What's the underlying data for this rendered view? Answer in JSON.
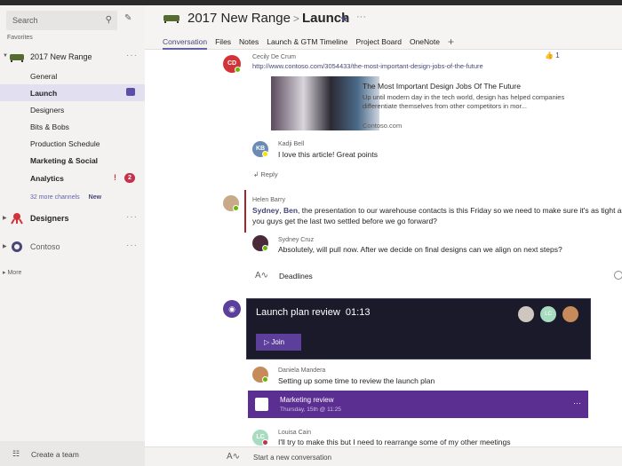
{
  "sidebar": {
    "search_placeholder": "Search",
    "favorites_label": "Favorites",
    "teams": [
      {
        "name": "2017 New Range",
        "channels": [
          {
            "name": "General",
            "bold": false,
            "active": false
          },
          {
            "name": "Launch",
            "bold": true,
            "active": true,
            "meeting": true
          },
          {
            "name": "Designers",
            "bold": false,
            "active": false
          },
          {
            "name": "Bits & Bobs",
            "bold": false,
            "active": false
          },
          {
            "name": "Production Schedule",
            "bold": false,
            "active": false
          },
          {
            "name": "Marketing & Social",
            "bold": true,
            "active": false
          },
          {
            "name": "Analytics",
            "bold": true,
            "active": false,
            "important": "!",
            "badge": "2"
          }
        ],
        "more_channels": "32 more channels",
        "more_channels_tag": "New"
      },
      {
        "name": "Designers"
      },
      {
        "name": "Contoso"
      }
    ],
    "more_label": "More",
    "create_team": "Create a team"
  },
  "header": {
    "team": "2017 New Range",
    "channel": "Launch",
    "separator": ">",
    "more": "···",
    "tabs": [
      "Conversation",
      "Files",
      "Notes",
      "Launch & GTM Timeline",
      "Project Board",
      "OneNote"
    ],
    "active_tab": "Conversation",
    "add_tab": "+"
  },
  "thread1": {
    "author": "Cecily De Crum",
    "initials": "CD",
    "link": "http://www.contoso.com/3054433/the-most-important-design-jobs-of-the-future",
    "likes": "1",
    "card": {
      "title": "The Most Important Design Jobs Of The Future",
      "desc": "Up until modern day in the tech world, design has helped companies differentiate themselves from other competitors in mor...",
      "source": "Contoso.com"
    },
    "reply": {
      "author": "Kadji Bell",
      "initials": "KB",
      "text": "I love this article! Great points"
    },
    "reply_label": "Reply"
  },
  "thread2": {
    "author": "Helen Barry",
    "mention1": "Sydney",
    "mention2": "Ben",
    "text1": ", the presentation to our warehouse contacts is this Friday so we need to make sure it's as tight as po",
    "text2": "you guys get the last two settled before we go forward?",
    "reply": {
      "author": "Sydney Cruz",
      "text": "Absolutely, will pull now. After we decide on final designs can we align on next steps?"
    },
    "subject": "Deadlines"
  },
  "meeting": {
    "title": "Launch plan review",
    "time": "01:13",
    "join": "Join",
    "participant_initials": "LC",
    "reply": {
      "author": "Daniela Mandera",
      "text": "Setting up some time to review the launch plan"
    },
    "event": {
      "title": "Marketing review",
      "when": "Thursday, 15th @ 11:25"
    },
    "reply2": {
      "author": "Louisa Cain",
      "initials": "LC",
      "text": "I'll try to make this but I need to rearrange some of my other meetings"
    }
  },
  "compose": {
    "placeholder": "Start a new conversation"
  }
}
